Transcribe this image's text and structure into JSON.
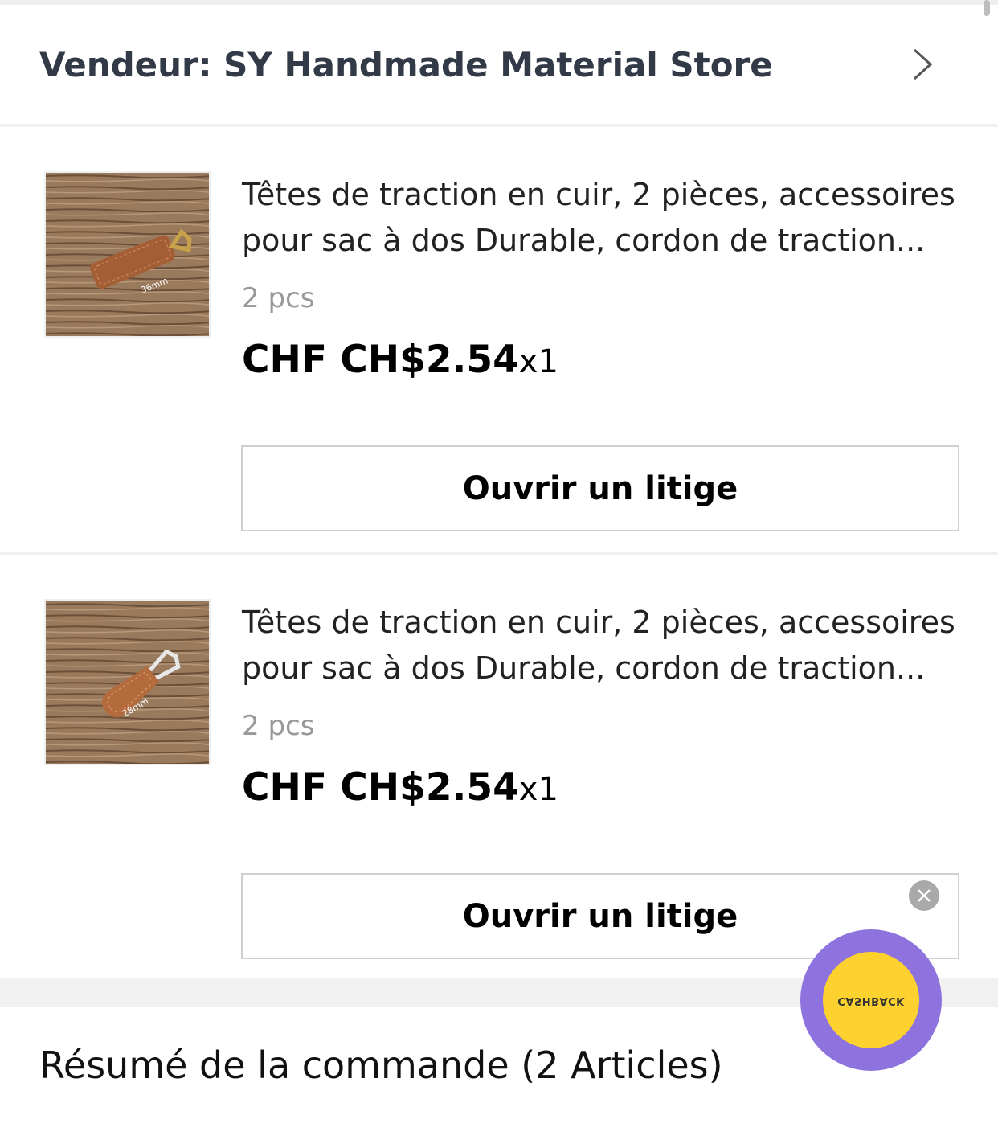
{
  "seller": {
    "label": "Vendeur: SY Handmade Material Store"
  },
  "items": [
    {
      "title_line1": "Têtes de traction en cuir, 2 pièces, accessoires",
      "title_line2": "pour sac à dos Durable, cordon de traction...",
      "sku": "2 pcs",
      "price": "CHF CH$2.54",
      "quantity": "x1",
      "dispute_label": "Ouvrir un litige",
      "image_text": "36mm"
    },
    {
      "title_line1": "Têtes de traction en cuir, 2 pièces, accessoires",
      "title_line2": "pour sac à dos Durable, cordon de traction...",
      "sku": "2 pcs",
      "price": "CHF CH$2.54",
      "quantity": "x1",
      "dispute_label": "Ouvrir un litige",
      "image_text": "28mm"
    }
  ],
  "summary": {
    "label": "Résumé de la commande (2 Articles)"
  },
  "cashback": {
    "label": "CASHBACK"
  },
  "colors": {
    "cashback_ring": "#8e72de",
    "cashback_fill": "#fdd22e",
    "seller_text": "#333a47"
  },
  "icons": {
    "seller_chevron": "chevron-right-icon",
    "close": "close-icon"
  }
}
